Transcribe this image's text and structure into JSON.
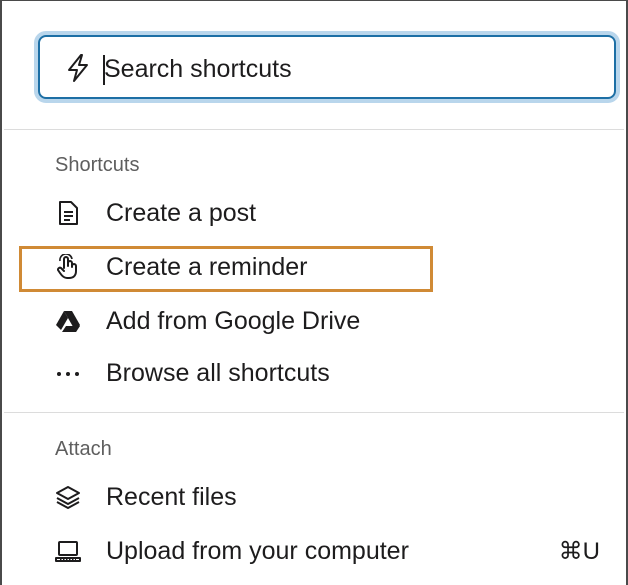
{
  "search": {
    "placeholder": "Search shortcuts",
    "value": ""
  },
  "sections": {
    "shortcuts": {
      "label": "Shortcuts",
      "items": [
        {
          "label": "Create a post",
          "icon": "document-icon"
        },
        {
          "label": "Create a reminder",
          "icon": "hand-pointer-icon"
        },
        {
          "label": "Add from Google Drive",
          "icon": "google-drive-icon"
        },
        {
          "label": "Browse all shortcuts",
          "icon": "more-dots-icon"
        }
      ]
    },
    "attach": {
      "label": "Attach",
      "items": [
        {
          "label": "Recent files",
          "icon": "layers-icon"
        },
        {
          "label": "Upload from your computer",
          "icon": "laptop-icon",
          "shortcut": "⌘U"
        }
      ]
    }
  },
  "colors": {
    "accent": "#1d6fa5",
    "focus_ring": "#b9d6ec",
    "highlight": "#d08a35"
  }
}
